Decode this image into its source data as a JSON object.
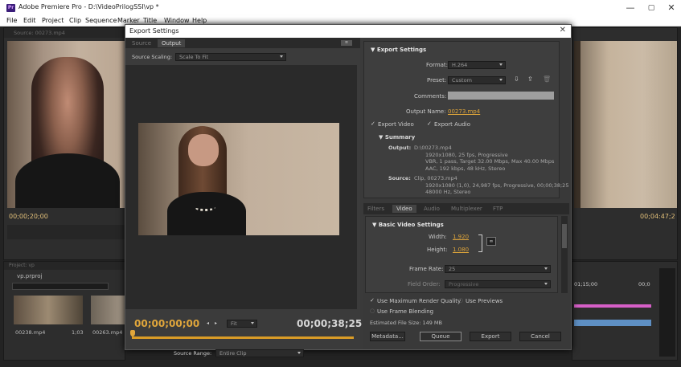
{
  "window": {
    "title": "Adobe Premiere Pro - D:\\VideoPrilogSSI\\vp *",
    "app_icon": "Pr",
    "min": "—",
    "max": "▢",
    "close": "✕"
  },
  "menu": [
    "File",
    "Edit",
    "Project",
    "Clip",
    "Sequence",
    "Marker",
    "Title",
    "Window",
    "Help"
  ],
  "background": {
    "source_panel_tab": "Source: 00273.mp4",
    "left_timecode": "00;00;20;00",
    "right_timecode": "00;04:47;2",
    "project_tab": "Project: vp",
    "project_file": "vp.prproj",
    "clip1_name": "00238.mp4",
    "clip1_dur": "1;03",
    "clip2_name": "00263.mp4",
    "timeline_time": "01;15;00",
    "timeline_time2": "00;0"
  },
  "dialog": {
    "title": "Export Settings",
    "close_icon": "✕",
    "left_tabs": [
      "Source",
      "Output"
    ],
    "active_left_tab": "Output",
    "source_scaling_label": "Source Scaling:",
    "source_scaling_value": "Scale To Fit",
    "timecode_in": "00;00;00;00",
    "timecode_out": "00;00;38;25",
    "fit_value": "Fit",
    "source_range_label": "Source Range:",
    "source_range_value": "Entire Clip",
    "export_settings_header": "Export Settings",
    "format_label": "Format:",
    "format_value": "H.264",
    "preset_label": "Preset:",
    "preset_value": "Custom",
    "comments_label": "Comments:",
    "output_name_label": "Output Name:",
    "output_name_value": "00273.mp4",
    "export_video": "Export Video",
    "export_audio": "Export Audio",
    "summary_header": "Summary",
    "output_label": "Output:",
    "output_lines": [
      "D:\\00273.mp4",
      "1920x1080, 25 fps, Progressive",
      "VBR, 1 pass, Target 32.00 Mbps, Max 40.00 Mbps",
      "AAC, 192 kbps, 48 kHz, Stereo"
    ],
    "source_label": "Source:",
    "source_lines": [
      "Clip, 00273.mp4",
      "1920x1080 (1,0), 24,987 fps, Progressive, 00;00;38;25",
      "48000 Hz, Stereo"
    ],
    "right_tabs": [
      "Filters",
      "Video",
      "Audio",
      "Multiplexer",
      "FTP"
    ],
    "active_right_tab": "Video",
    "basic_video_header": "Basic Video Settings",
    "width_label": "Width:",
    "width_value": "1.920",
    "height_label": "Height:",
    "height_value": "1.080",
    "frame_rate_label": "Frame Rate:",
    "frame_rate_value": "25",
    "field_order_label": "Field Order:",
    "field_order_value": "Progressive",
    "use_max_render": "Use Maximum Render Quality",
    "use_previews": "Use Previews",
    "use_frame_blending": "Use Frame Blending",
    "estimated_size": "Estimated File Size: 149 MB",
    "metadata_btn": "Metadata...",
    "queue_btn": "Queue",
    "export_btn": "Export",
    "cancel_btn": "Cancel"
  }
}
